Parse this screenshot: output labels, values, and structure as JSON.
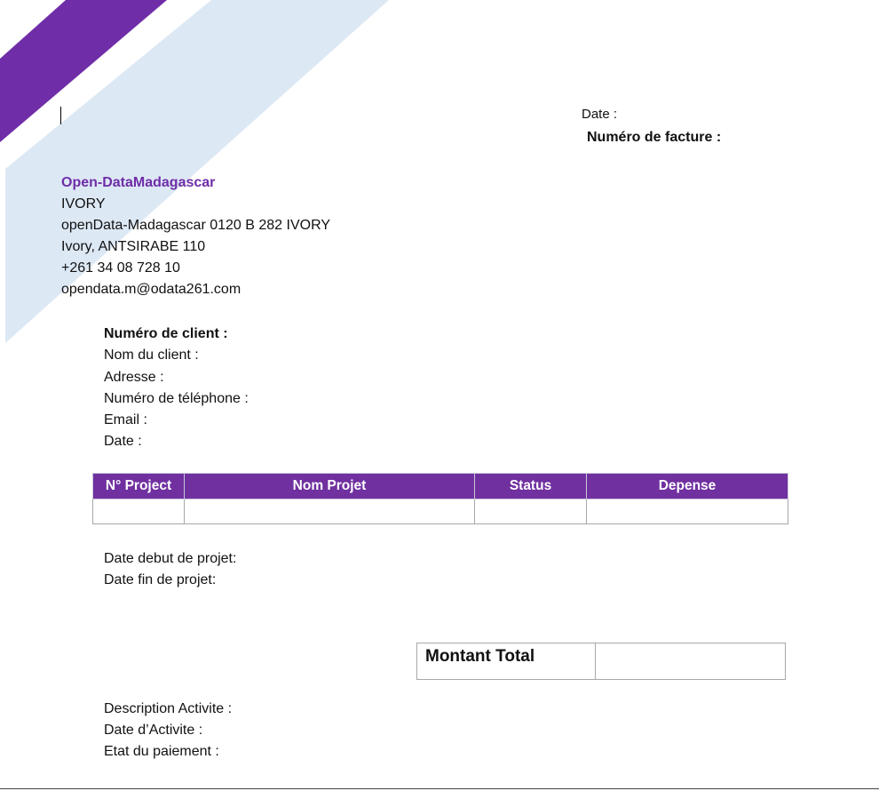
{
  "header": {
    "date_label": "Date  :",
    "invoice_number_label": "Numéro de facture :"
  },
  "company": {
    "name": "Open-DataMadagascar",
    "city_line": "IVORY",
    "registration": "openData-Madagascar 0120 B 282 IVORY",
    "address": "Ivory, ANTSIRABE 110",
    "phone": "+261 34 08 728 10",
    "email": "opendata.m@odata261.com"
  },
  "client": {
    "number_label": "Numéro de client :",
    "name_label": "Nom du client :",
    "address_label": "Adresse :",
    "phone_label": "Numéro de téléphone :",
    "email_label": "Email :",
    "date_label": "Date :"
  },
  "projects_table": {
    "columns": [
      "N° Project",
      "Nom Projet",
      "Status",
      "Depense"
    ],
    "rows": [
      [
        "",
        "",
        "",
        ""
      ]
    ]
  },
  "project_dates": {
    "start_label": "Date debut de projet:",
    "end_label": "Date fin de projet:"
  },
  "total": {
    "label": "Montant Total",
    "value": ""
  },
  "activity": {
    "description_label": "Description Activite :",
    "date_label": "Date d’Activite :",
    "payment_status_label": "Etat du paiement :"
  },
  "colors": {
    "accent_purple": "#7030a0",
    "decor_light_blue": "#dde8f5"
  }
}
